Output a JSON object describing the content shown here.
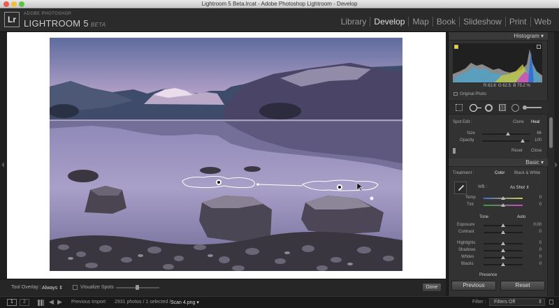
{
  "window": {
    "title": "Lightroom 5 Beta.lrcat - Adobe Photoshop Lightroom - Develop"
  },
  "brand": {
    "small": "ADOBE PHOTOSHOP",
    "big": "LIGHTROOM 5",
    "beta": "BETA",
    "logo": "Lr"
  },
  "modules": [
    {
      "label": "Library"
    },
    {
      "label": "Develop",
      "active": true
    },
    {
      "label": "Map"
    },
    {
      "label": "Book"
    },
    {
      "label": "Slideshow"
    },
    {
      "label": "Print"
    },
    {
      "label": "Web"
    }
  ],
  "histogram": {
    "title": "Histogram",
    "readout_r_label": "R",
    "readout_r": "62.6",
    "readout_g_label": "G",
    "readout_g": "62.5",
    "readout_b_label": "B",
    "readout_b": "75.2",
    "readout_unit": "%",
    "original_photo": "Original Photo"
  },
  "spot_edit": {
    "label": "Spot Edit :",
    "clone": "Clone",
    "heal": "Heal",
    "size_label": "Size",
    "size_value": "66",
    "opacity_label": "Opacity",
    "opacity_value": "100",
    "reset": "Reset",
    "close": "Close"
  },
  "basic": {
    "title": "Basic",
    "treatment_label": "Treatment :",
    "color": "Color",
    "bw": "Black & White",
    "wb_label": "WB :",
    "wb_value": "As Shot",
    "temp_label": "Temp",
    "temp_value": "0",
    "tint_label": "Tint",
    "tint_value": "0",
    "tone_label": "Tone",
    "auto": "Auto",
    "exposure_label": "Exposure",
    "exposure_value": "0.00",
    "contrast_label": "Contrast",
    "contrast_value": "0",
    "highlights_label": "Highlights",
    "highlights_value": "0",
    "shadows_label": "Shadows",
    "shadows_value": "0",
    "whites_label": "Whites",
    "whites_value": "0",
    "blacks_label": "Blacks",
    "blacks_value": "0",
    "presence_label": "Presence"
  },
  "panel_buttons": {
    "previous": "Previous",
    "reset": "Reset"
  },
  "toolbar": {
    "overlay_label": "Tool Overlay :",
    "overlay_value": "Always",
    "visualize_label": "Visualize Spots",
    "done": "Done"
  },
  "filmstrip": {
    "page1": "1",
    "page2": "2",
    "previous_import": "Previous Import",
    "count": "2931 photos / 1 selected /",
    "filename": "Scan 4.png",
    "filter_label": "Filter :",
    "filter_value": "Filters Off"
  },
  "colors": {
    "accent": "#e0e0e0",
    "panel": "#323232",
    "background": "#1f1f1f"
  }
}
